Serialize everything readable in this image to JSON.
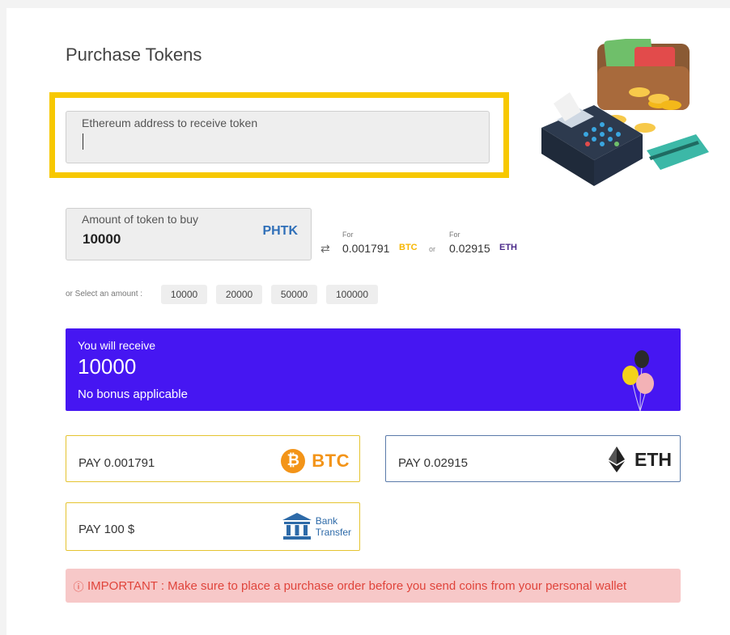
{
  "page": {
    "title": "Purchase Tokens"
  },
  "address": {
    "label": "Ethereum address to receive token",
    "value": ""
  },
  "amount": {
    "label": "Amount of token to buy",
    "value": "10000",
    "unit": "PHTK"
  },
  "conversion": {
    "for_label": "For",
    "btc_value": "0.001791",
    "btc_unit": "BTC",
    "or_label": "or",
    "eth_value": "0.02915",
    "eth_unit": "ETH"
  },
  "presets": {
    "label": "or Select an amount :",
    "options": [
      "10000",
      "20000",
      "50000",
      "100000"
    ]
  },
  "receive": {
    "label": "You will receive",
    "value": "10000",
    "bonus": "No bonus applicable"
  },
  "payments": {
    "btc": {
      "label": "PAY 0.001791",
      "brand": "BTC",
      "symbol": "₿"
    },
    "eth": {
      "label": "PAY 0.02915",
      "brand": "ETH"
    },
    "bank": {
      "label": "PAY 100 $",
      "brand_line1": "Bank",
      "brand_line2": "Transfer"
    }
  },
  "notice": {
    "icon": "ⓘ",
    "text": "IMPORTANT : Make sure to place a purchase order before you send coins from your personal wallet"
  },
  "icons": {
    "swap": "swap-arrows-icon",
    "illustration": "wallet-pos-terminal-illustration",
    "balloons": "balloons-icon"
  },
  "colors": {
    "highlight": "#f7c800",
    "receive_bg": "#4616f2",
    "btc": "#f39418",
    "eth": "#4b2a8a",
    "notice_bg": "#f7c8c8",
    "notice_text": "#e0443b"
  }
}
